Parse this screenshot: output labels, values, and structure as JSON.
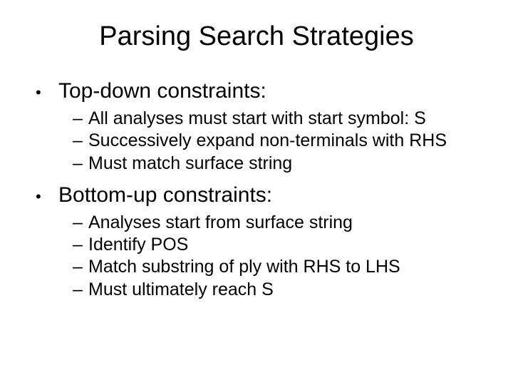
{
  "title": "Parsing Search Strategies",
  "sections": [
    {
      "heading": "Top-down constraints:",
      "items": [
        "All analyses must start with start symbol: S",
        "Successively expand non-terminals with RHS",
        "Must match surface string"
      ]
    },
    {
      "heading": "Bottom-up constraints:",
      "items": [
        "Analyses start from surface string",
        "Identify POS",
        "Match substring of ply with RHS to LHS",
        "Must ultimately reach S"
      ]
    }
  ]
}
